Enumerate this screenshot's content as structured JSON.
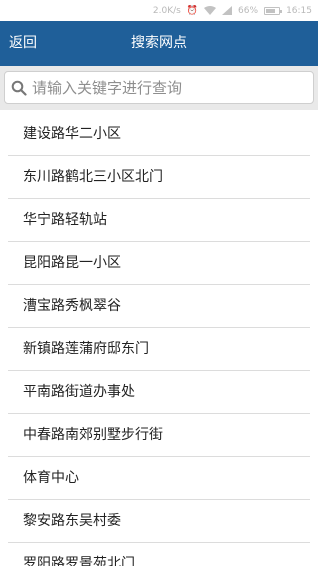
{
  "status_bar": {
    "network_speed": "2.0K/s",
    "battery_percent": "66%",
    "time": "16:15",
    "battery_level": 0.66
  },
  "navbar": {
    "back_label": "返回",
    "title": "搜索网点"
  },
  "search": {
    "placeholder": "请输入关键字进行查询",
    "value": ""
  },
  "list": {
    "items": [
      "建设路华二小区",
      "东川路鹤北三小区北门",
      "华宁路轻轨站",
      "昆阳路昆一小区",
      "漕宝路秀枫翠谷",
      "新镇路莲蒲府邸东门",
      "平南路街道办事处",
      "中春路南郊别墅步行街",
      "体育中心",
      "黎安路东吴村委",
      "罗阳路罗景苑北门"
    ]
  },
  "colors": {
    "navbar": "#1f5f99",
    "search_bg": "#e9e9e9",
    "divider": "#dcdcdc"
  }
}
